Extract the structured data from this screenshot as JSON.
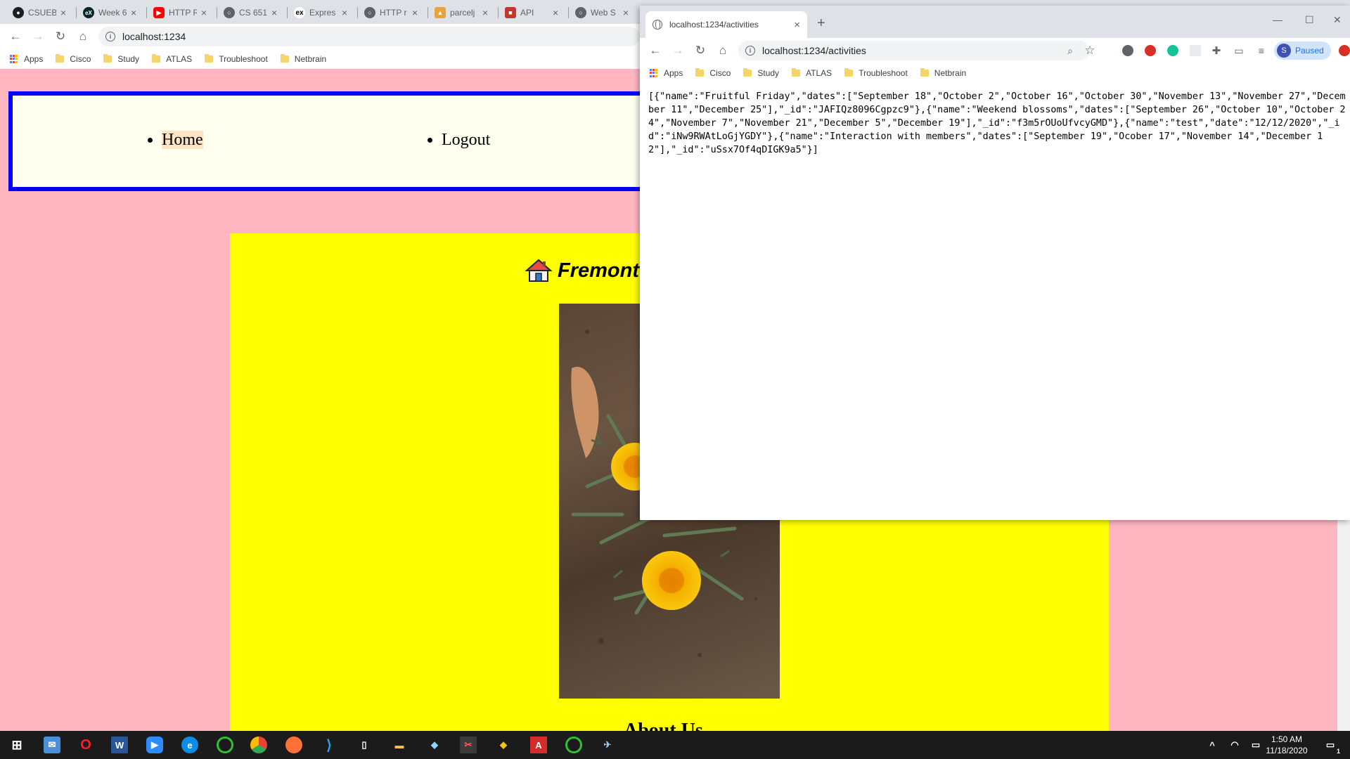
{
  "back_browser": {
    "tabs": [
      {
        "label": "CSUEB",
        "icon": "github-icon",
        "color": "#1b1f23"
      },
      {
        "label": "Week 6",
        "icon": "edx-icon",
        "color": "#02262b"
      },
      {
        "label": "HTTP R",
        "icon": "youtube-icon",
        "color": "#ff0000"
      },
      {
        "label": "CS 651",
        "icon": "globe-icon",
        "color": "#5f6368"
      },
      {
        "label": "Expres",
        "icon": "express-icon",
        "color": "#000000"
      },
      {
        "label": "HTTP r",
        "icon": "globe-icon",
        "color": "#5f6368"
      },
      {
        "label": "parcelj",
        "icon": "parcel-icon",
        "color": "#e8a33d"
      },
      {
        "label": "API",
        "icon": "api-icon",
        "color": "#c0392b"
      },
      {
        "label": "Web S",
        "icon": "globe-icon",
        "color": "#5f6368"
      }
    ],
    "url": "localhost:1234",
    "bookmarks": [
      "Apps",
      "Cisco",
      "Study",
      "ATLAS",
      "Troubleshoot",
      "Netbrain"
    ],
    "page": {
      "nav": [
        "Home",
        "Logout"
      ],
      "site_title": "Fremont",
      "about_heading": "About Us"
    }
  },
  "front_browser": {
    "tab_title": "localhost:1234/activities",
    "url": "localhost:1234/activities",
    "profile_initial": "S",
    "profile_status": "Paused",
    "bookmarks": [
      "Apps",
      "Cisco",
      "Study",
      "ATLAS",
      "Troubleshoot",
      "Netbrain"
    ],
    "json_body": "[{\"name\":\"Fruitful Friday\",\"dates\":[\"September 18\",\"October 2\",\"October 16\",\"October 30\",\"November 13\",\"November 27\",\"December 11\",\"December 25\"],\"_id\":\"JAFIQz8096Cgpzc9\"},{\"name\":\"Weekend blossoms\",\"dates\":[\"September 26\",\"October 10\",\"October 24\",\"November 7\",\"November 21\",\"December 5\",\"December 19\"],\"_id\":\"f3m5rOUoUfvcyGMD\"},{\"name\":\"test\",\"date\":\"12/12/2020\",\"_id\":\"iNw9RWAtLoGjYGDY\"},{\"name\":\"Interaction with members\",\"dates\":[\"September 19\",\"Ocober 17\",\"November 14\",\"December 12\"],\"_id\":\"uSsx7Of4qDIGK9a5\"}]"
  },
  "taskbar": {
    "time": "1:50 AM",
    "date": "11/18/2020",
    "notification_count": "1"
  },
  "colors": {
    "page_bg": "#ffb6c1",
    "nav_border": "#0000ff",
    "content_bg": "#ffff00"
  }
}
